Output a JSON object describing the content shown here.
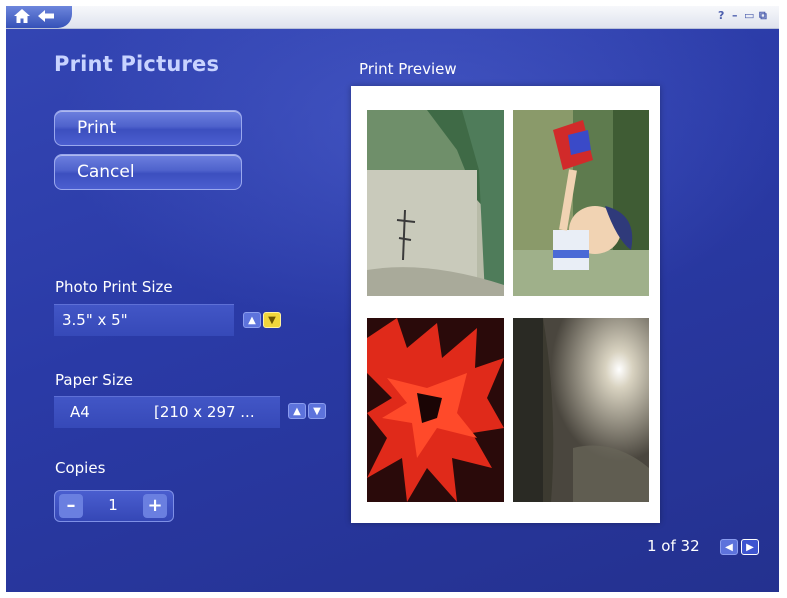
{
  "window": {
    "controls": [
      "?",
      "–",
      "▭",
      "⧉"
    ]
  },
  "heading": "Print Pictures",
  "buttons": {
    "print": "Print",
    "cancel": "Cancel"
  },
  "photo_size": {
    "label": "Photo Print Size",
    "value": "3.5\" x 5\""
  },
  "paper_size": {
    "label": "Paper Size",
    "value": "A4",
    "dimensions": "[210 x 297 ..."
  },
  "copies": {
    "label": "Copies",
    "value": "1",
    "decrement": "–",
    "increment": "+"
  },
  "preview": {
    "title": "Print Preview",
    "page_indicator": "1 of 32"
  },
  "icons": {
    "home": "home-icon",
    "back": "back-arrow-icon",
    "up": "chevron-up-icon",
    "down": "chevron-down-icon",
    "prev": "chevron-left-icon",
    "next": "chevron-right-icon"
  },
  "colors": {
    "background": "#2a3a9e",
    "accent": "#f0d63c",
    "heading": "#c8d3ff"
  }
}
